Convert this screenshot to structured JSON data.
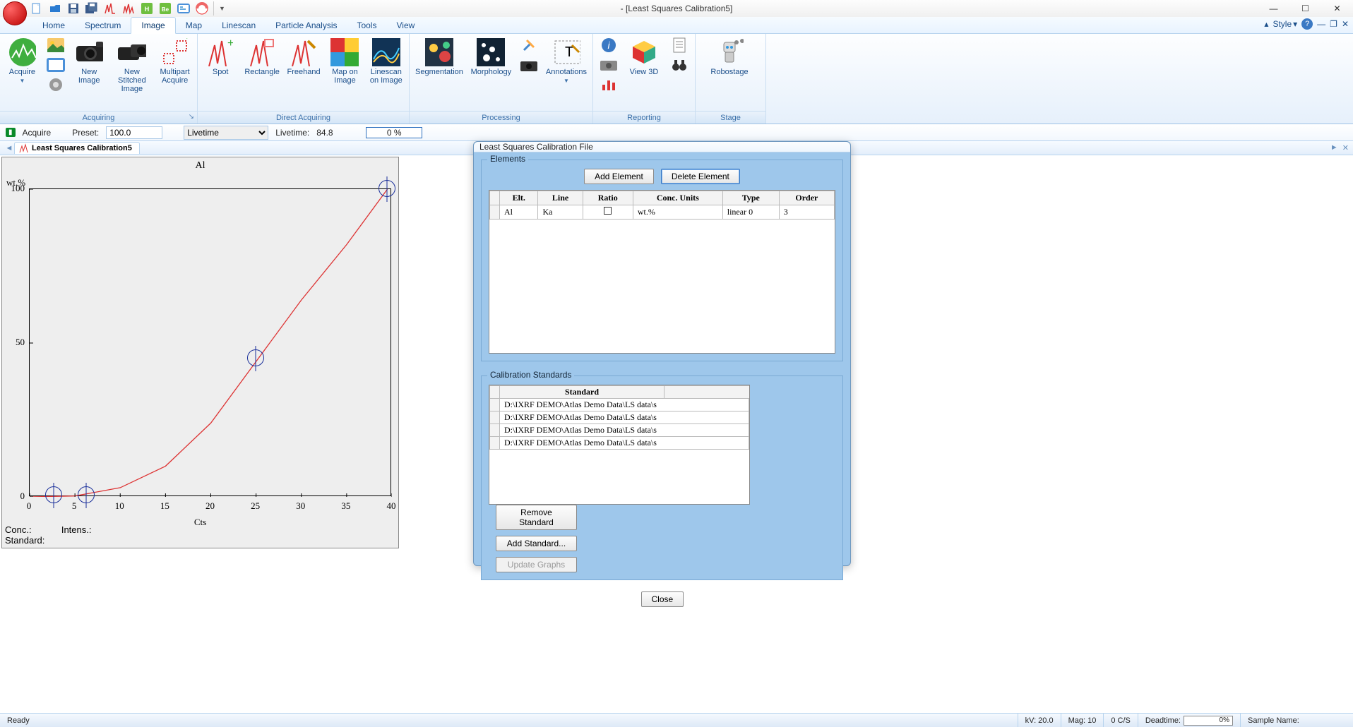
{
  "window": {
    "title": "- [Least Squares Calibration5]"
  },
  "menu_tabs": [
    "Home",
    "Spectrum",
    "Image",
    "Map",
    "Linescan",
    "Particle Analysis",
    "Tools",
    "View"
  ],
  "menu_active": "Image",
  "ribbon_right": {
    "style_label": "Style"
  },
  "ribbon_groups": {
    "acquiring": {
      "label": "Acquiring",
      "buttons": [
        {
          "id": "acquire",
          "label": "Acquire"
        },
        {
          "id": "new-image",
          "label": "New Image"
        },
        {
          "id": "new-stitched-image",
          "label": "New Stitched Image"
        },
        {
          "id": "multipart-acquire",
          "label": "Multipart Acquire"
        }
      ]
    },
    "direct": {
      "label": "Direct Acquiring",
      "buttons": [
        {
          "id": "spot",
          "label": "Spot"
        },
        {
          "id": "rectangle",
          "label": "Rectangle"
        },
        {
          "id": "freehand",
          "label": "Freehand"
        },
        {
          "id": "map-on-image",
          "label": "Map on Image"
        },
        {
          "id": "linescan-on-image",
          "label": "Linescan on Image"
        }
      ]
    },
    "processing": {
      "label": "Processing",
      "buttons": [
        {
          "id": "segmentation",
          "label": "Segmentation"
        },
        {
          "id": "morphology",
          "label": "Morphology"
        },
        {
          "id": "annotations",
          "label": "Annotations"
        }
      ]
    },
    "reporting": {
      "label": "Reporting",
      "buttons": [
        {
          "id": "view-3d",
          "label": "View 3D"
        }
      ]
    },
    "stage": {
      "label": "Stage",
      "buttons": [
        {
          "id": "robostage",
          "label": "Robostage"
        }
      ]
    }
  },
  "infobar": {
    "acquire_label": "Acquire",
    "preset_label": "Preset:",
    "preset_value": "100.0",
    "mode": "Livetime",
    "livetime_label": "Livetime:",
    "livetime_value": "84.8",
    "progress": "0 %"
  },
  "doc_tab": {
    "label": "Least Squares Calibration5"
  },
  "chart_data": {
    "type": "line",
    "title": "Al",
    "ylabel": "wt.%",
    "xlabel": "Cts",
    "xlim": [
      0,
      40
    ],
    "ylim": [
      0,
      100
    ],
    "xticks": [
      0,
      5,
      10,
      15,
      20,
      25,
      30,
      35,
      40
    ],
    "yticks": [
      0,
      50,
      100
    ],
    "points": [
      {
        "x": 2.7,
        "y": 0.5
      },
      {
        "x": 6.3,
        "y": 0.5
      },
      {
        "x": 25,
        "y": 45
      },
      {
        "x": 39.5,
        "y": 100
      }
    ],
    "curve": [
      {
        "x": 0,
        "y": 0
      },
      {
        "x": 5,
        "y": 0.3
      },
      {
        "x": 10,
        "y": 3
      },
      {
        "x": 15,
        "y": 10
      },
      {
        "x": 20,
        "y": 24
      },
      {
        "x": 25,
        "y": 44
      },
      {
        "x": 30,
        "y": 64
      },
      {
        "x": 35,
        "y": 82
      },
      {
        "x": 39.5,
        "y": 100
      }
    ]
  },
  "chart_footer": {
    "conc": "Conc.:",
    "intens": "Intens.:",
    "standard": "Standard:"
  },
  "dialog": {
    "title": "Least Squares Calibration File",
    "elements_label": "Elements",
    "add_element": "Add Element",
    "delete_element": "Delete Element",
    "headers": [
      "Elt.",
      "Line",
      "Ratio",
      "Conc. Units",
      "Type",
      "Order"
    ],
    "rows": [
      [
        "Al",
        "Ka",
        "",
        "wt.%",
        "linear 0",
        "3"
      ]
    ],
    "cal_std_label": "Calibration Standards",
    "std_header": "Standard",
    "std_rows": [
      "D:\\IXRF DEMO\\Atlas Demo Data\\LS data\\s",
      "D:\\IXRF DEMO\\Atlas Demo Data\\LS data\\s",
      "D:\\IXRF DEMO\\Atlas Demo Data\\LS data\\s",
      "D:\\IXRF DEMO\\Atlas Demo Data\\LS data\\s"
    ],
    "remove_std": "Remove Standard",
    "add_std": "Add Standard...",
    "update_graphs": "Update Graphs",
    "close": "Close"
  },
  "statusbar": {
    "ready": "Ready",
    "kv": "kV:  20.0",
    "mag": "Mag:  10",
    "cs": "0 C/S",
    "deadtime_label": "Deadtime:",
    "deadtime_value": "0%",
    "sample_name": "Sample Name:"
  }
}
